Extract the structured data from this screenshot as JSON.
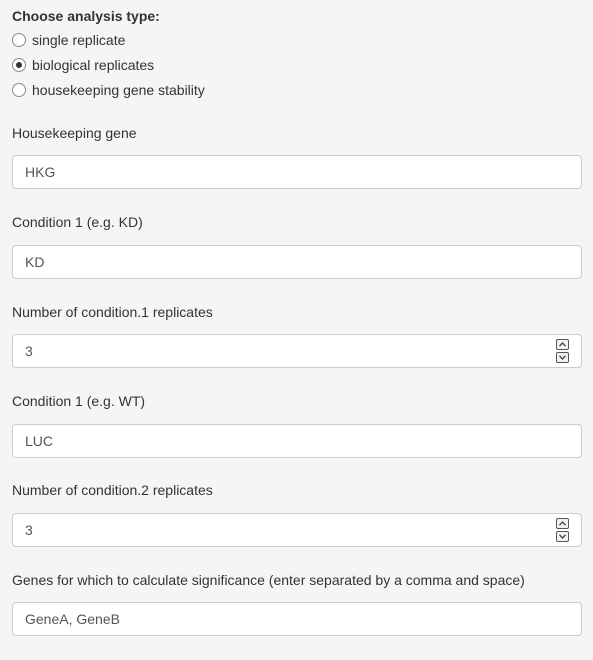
{
  "analysis": {
    "heading": "Choose analysis type:",
    "options": [
      {
        "label": "single replicate",
        "selected": false
      },
      {
        "label": "biological replicates",
        "selected": true
      },
      {
        "label": "housekeeping gene stability",
        "selected": false
      }
    ]
  },
  "fields": {
    "housekeeping": {
      "label": "Housekeeping gene",
      "value": "HKG"
    },
    "condition1": {
      "label": "Condition 1 (e.g. KD)",
      "value": "KD"
    },
    "cond1_reps": {
      "label": "Number of condition.1 replicates",
      "value": "3"
    },
    "condition2": {
      "label": "Condition 1 (e.g. WT)",
      "value": "LUC"
    },
    "cond2_reps": {
      "label": "Number of condition.2 replicates",
      "value": "3"
    },
    "genes": {
      "label": "Genes for which to calculate significance (enter separated by a comma and space)",
      "value": "GeneA, GeneB"
    }
  },
  "icons": {
    "spinner_up": "chevron-up-icon",
    "spinner_down": "chevron-down-icon"
  }
}
